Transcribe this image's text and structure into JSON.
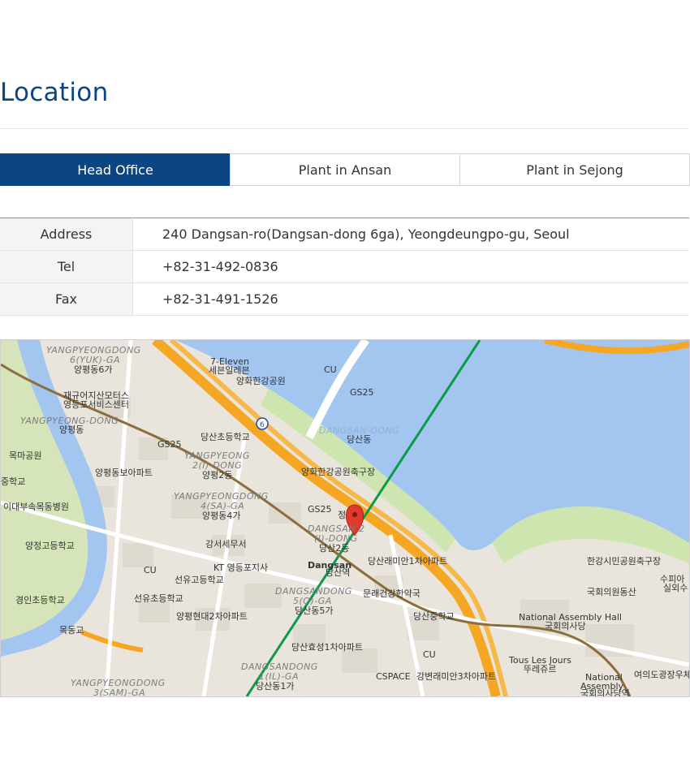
{
  "page": {
    "title": "Location"
  },
  "tabs": [
    {
      "label": "Head Office",
      "active": true
    },
    {
      "label": "Plant in Ansan",
      "active": false
    },
    {
      "label": "Plant in Sejong",
      "active": false
    }
  ],
  "info": [
    {
      "label": "Address",
      "value": "240 Dangsan-ro(Dangsan-dong 6ga), Yeongdeungpo-gu, Seoul"
    },
    {
      "label": "Tel",
      "value": "+82-31-492-0836"
    },
    {
      "label": "Fax",
      "value": "+82-31-491-1526"
    }
  ],
  "map": {
    "colors": {
      "water": "#a3c6f0",
      "park": "#cfe5b0",
      "highway": "#f5a623",
      "subway_green": "#0a9a4a",
      "subway_brown": "#8b6e3c",
      "marker": "#e03a2f"
    },
    "labels": {
      "yangpyeong6": "YANGPYEONGDONG",
      "yangpyeong6b": "6(YUK)-GA",
      "yangpyeong6k": "양평동6가",
      "seven_eleven": "7-Eleven",
      "seven_eleven_k": "세븐일레븐",
      "cu_top": "CU",
      "gs25_top": "GS25",
      "hangang_park": "양화한강공원",
      "motors": "재규어지산모터스",
      "motors2": "영등포서비스센터",
      "yangpyeongdong": "YANGPYEONG-DONG",
      "yangpyeongdong_k": "양평동",
      "gs25_left": "GS25",
      "dangsan_elem": "당산초등학교",
      "dangsandong": "DANGSAN-DONG",
      "dangsandong_k": "당산동",
      "yp2_1": "YANGPYEONG",
      "yp2_2": "2(I)-DONG",
      "yp2_k": "양평2동",
      "mokma_park": "목마공원",
      "yp_apt": "양평동보아파트",
      "hangang_soccer": "양화한강공원축구장",
      "school_edge": "중학교",
      "yp4_1": "YANGPYEONGDONG",
      "yp4_2": "4(SA)-GA",
      "yp4_k": "양평동4가",
      "gs25_mid": "GS25",
      "ewha_hospital": "이대부속목동병원",
      "dangsan2_1": "DANGSAN 2",
      "dangsan2_2": "(I)-DONG",
      "dangsan2_k": "당산2동",
      "tax_office": "강서세무서",
      "yangjeong_high": "양정고등학교",
      "dangsan_station": "Dangsan",
      "dangsan_station_k": "당산역",
      "raemian1": "당산래미안1차아파트",
      "cu_mid": "CU",
      "kt_office": "KT 영등포지사",
      "seonyu_high": "선유고등학교",
      "hangang_citizen": "한강시민공원축구장",
      "supia": "수피아",
      "silwoesu": "실외수",
      "dangsan5_1": "DANGSANDONG",
      "dangsan5_2": "5(O)-GA",
      "dangsan5_k": "당산동5가",
      "munrae": "문래건강한약국",
      "gyeongin_elem": "경인초등학교",
      "seonyu_elem": "선유초등학교",
      "hyundai_apt": "양평현대2차아파트",
      "assembly_park": "국회의원동산",
      "dangsan_middle": "당산중학교",
      "assembly_hall": "National Assembly Hall",
      "assembly_hall_k": "국회의사당",
      "mokdong_bridge": "목동교",
      "hyosung_apt": "당산효성1차아파트",
      "cu_bottom": "CU",
      "tous": "Tous Les Jours",
      "tous_k": "뚜레쥬르",
      "dangsan1_1": "DANGSANDONG",
      "dangsan1_2": "1(IL)-GA",
      "dangsan1_k": "당산동1가",
      "cspace": "CSPACE",
      "raemian3": "강변래미안3차아파트",
      "assembly_station": "National",
      "assembly_station2": "Assembly",
      "assembly_station_k": "국회의사당역",
      "yeouido_post": "여의도광장우체",
      "yp3_1": "YANGPYEONGDONG",
      "yp3_2": "3(SAM)-GA",
      "dangsan_mid_label": "정",
      "line6": "6"
    }
  }
}
